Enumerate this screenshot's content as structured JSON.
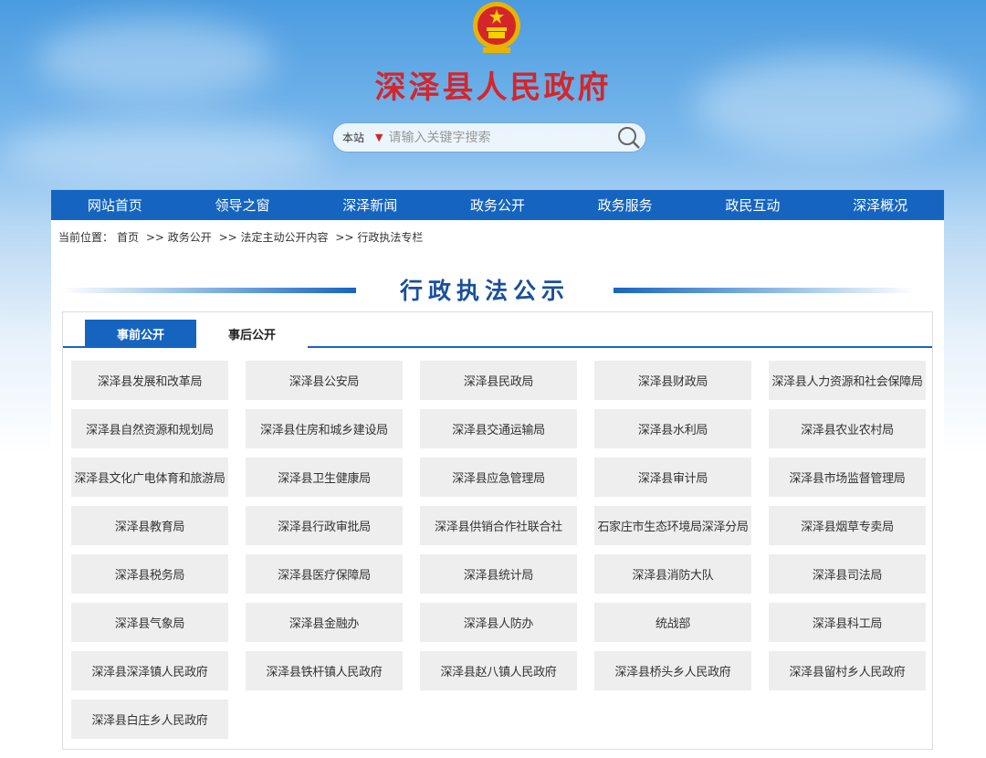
{
  "site": {
    "title": "深泽县人民政府"
  },
  "search": {
    "scope": "本站",
    "placeholder": "请输入关键字搜索"
  },
  "nav": [
    "网站首页",
    "领导之窗",
    "深泽新闻",
    "政务公开",
    "政务服务",
    "政民互动",
    "深泽概况"
  ],
  "breadcrumb": {
    "prefix": "当前位置：",
    "items": [
      "首页",
      ">> 政务公开",
      ">> 法定主动公开内容",
      ">> 行政执法专栏"
    ]
  },
  "section_title": "行政执法公示",
  "tabs": [
    {
      "label": "事前公开",
      "active": true
    },
    {
      "label": "事后公开",
      "active": false
    }
  ],
  "units": [
    "深泽县发展和改革局",
    "深泽县公安局",
    "深泽县民政局",
    "深泽县财政局",
    "深泽县人力资源和社会保障局",
    "深泽县自然资源和规划局",
    "深泽县住房和城乡建设局",
    "深泽县交通运输局",
    "深泽县水利局",
    "深泽县农业农村局",
    "深泽县文化广电体育和旅游局",
    "深泽县卫生健康局",
    "深泽县应急管理局",
    "深泽县审计局",
    "深泽县市场监督管理局",
    "深泽县教育局",
    "深泽县行政审批局",
    "深泽县供销合作社联合社",
    "石家庄市生态环境局深泽分局",
    "深泽县烟草专卖局",
    "深泽县税务局",
    "深泽县医疗保障局",
    "深泽县统计局",
    "深泽县消防大队",
    "深泽县司法局",
    "深泽县气象局",
    "深泽县金融办",
    "深泽县人防办",
    "统战部",
    "深泽县科工局",
    "深泽县深泽镇人民政府",
    "深泽县铁杆镇人民政府",
    "深泽县赵八镇人民政府",
    "深泽县桥头乡人民政府",
    "深泽县留村乡人民政府",
    "深泽县白庄乡人民政府"
  ],
  "colors": {
    "nav_bg": "#1565c0",
    "title_red": "#d4262a",
    "section_title_blue": "#1a4f9c",
    "unit_bg": "#eeeeee"
  },
  "icons": {
    "emblem": "national-emblem-icon",
    "search": "search-icon",
    "dropdown": "triangle-down-icon"
  }
}
